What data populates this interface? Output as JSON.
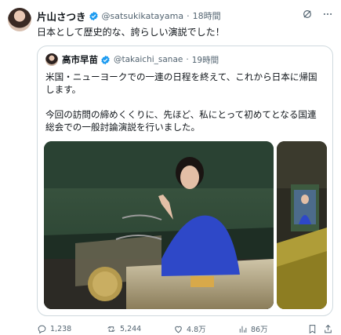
{
  "post": {
    "author_name": "片山さつき",
    "author_handle": "@satsukikatayama",
    "separator": "·",
    "time": "18時間",
    "text": "日本として歴史的な、誇らしい演説でした！"
  },
  "quote": {
    "author_name": "高市早苗",
    "author_handle": "@takaichi_sanae",
    "separator": "·",
    "time": "19時間",
    "paragraph1": "米国・ニューヨークでの一連の日程を終えて、これから日本に帰国します。",
    "paragraph2": "今回の訪問の締めくくりに、先ほど、私にとって初めてとなる国連総会での一般討論演説を行いました。"
  },
  "actions": {
    "replies": "1,238",
    "reposts": "5,244",
    "likes": "4.8万",
    "views": "86万"
  },
  "colors": {
    "verified_badge": "#1d9bf0",
    "secondary_text": "#536471",
    "border": "#cfd9de"
  }
}
